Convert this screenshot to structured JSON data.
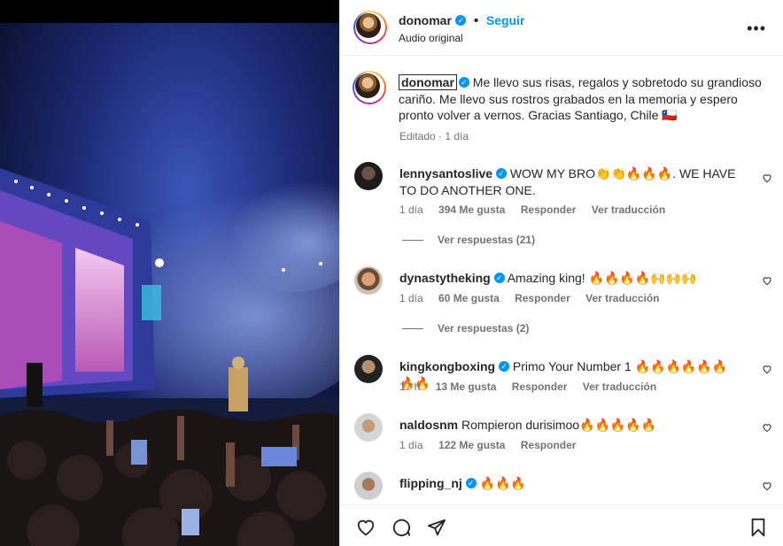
{
  "post": {
    "username": "donomar",
    "verified_mark": "✓",
    "dot": "•",
    "follow": "Seguir",
    "audio": "Audio original",
    "more": "•••"
  },
  "caption": {
    "username": "donomar",
    "text": "Me llevo sus risas, regalos y sobretodo su grandioso cariño. Me llevo sus rostros grabados en la memoria y espero pronto volver a vernos. Gracias Santiago, Chile 🇨🇱",
    "meta": "Editado · 1 día"
  },
  "comments": [
    {
      "username": "lennysantoslive",
      "text": "WOW MY BRO👏👏🔥🔥🔥. WE HAVE TO DO ANOTHER ONE.",
      "time": "1 día",
      "likes": "394 Me gusta",
      "reply": "Responder",
      "translate": "Ver traducción",
      "replies": "Ver respuestas (21)"
    },
    {
      "username": "dynastytheking",
      "text": "Amazing king! 🔥🔥🔥🔥🙌🙌🙌",
      "time": "1 día",
      "likes": "60 Me gusta",
      "reply": "Responder",
      "translate": "Ver traducción",
      "replies": "Ver respuestas (2)"
    },
    {
      "username": "kingkongboxing",
      "text": "Primo Your Number 1 🔥🔥🔥🔥🔥🔥🔥🔥",
      "time": "17 h",
      "likes": "13 Me gusta",
      "reply": "Responder",
      "translate": "Ver traducción"
    },
    {
      "username": "naldosnm",
      "text": "Rompieron durisimoo🔥🔥🔥🔥🔥",
      "time": "1 día",
      "likes": "122 Me gusta",
      "reply": "Responder"
    },
    {
      "username": "flipping_nj",
      "text": "🔥🔥🔥"
    }
  ],
  "icons": [
    "heart-icon",
    "comment-icon",
    "share-icon",
    "bookmark-icon",
    "more-icon",
    "verified-icon"
  ],
  "colors": {
    "link": "#0095f6",
    "text": "#262626",
    "muted": "#737373"
  }
}
